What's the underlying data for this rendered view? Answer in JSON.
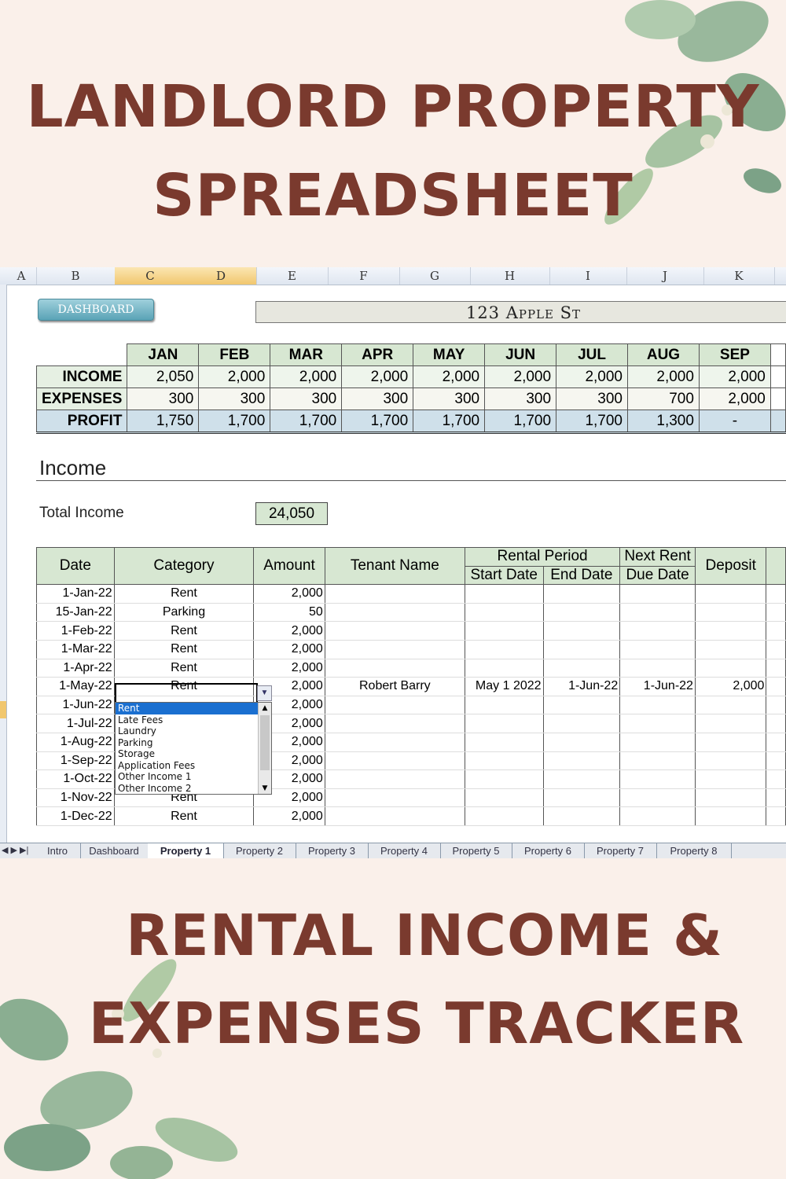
{
  "header": {
    "line1": "LANDLORD PROPERTY",
    "line2": "SPREADSHEET"
  },
  "footer": {
    "line1": "RENTAL INCOME &",
    "line2": "EXPENSES TRACKER"
  },
  "sheet": {
    "columns": [
      "A",
      "B",
      "C",
      "D",
      "E",
      "F",
      "G",
      "H",
      "I",
      "J",
      "K"
    ],
    "dashboard_button": "DASHBOARD",
    "address": "123 Apple St",
    "summary": {
      "months": [
        "JAN",
        "FEB",
        "MAR",
        "APR",
        "MAY",
        "JUN",
        "JUL",
        "AUG",
        "SEP"
      ],
      "rows": [
        {
          "label": "INCOME",
          "values": [
            "2,050",
            "2,000",
            "2,000",
            "2,000",
            "2,000",
            "2,000",
            "2,000",
            "2,000",
            "2,000"
          ]
        },
        {
          "label": "EXPENSES",
          "values": [
            "300",
            "300",
            "300",
            "300",
            "300",
            "300",
            "300",
            "700",
            "2,000"
          ]
        },
        {
          "label": "PROFIT",
          "values": [
            "1,750",
            "1,700",
            "1,700",
            "1,700",
            "1,700",
            "1,700",
            "1,700",
            "1,300",
            "-"
          ]
        }
      ]
    },
    "income_title": "Income",
    "total_income_label": "Total Income",
    "total_income_value": "24,050",
    "detail_headers": {
      "date": "Date",
      "category": "Category",
      "amount": "Amount",
      "tenant": "Tenant Name",
      "rental_period": "Rental Period",
      "start": "Start Date",
      "end": "End Date",
      "next_rent": "Next Rent",
      "due_date": "Due Date",
      "deposit": "Deposit"
    },
    "detail_rows": [
      {
        "date": "1-Jan-22",
        "category": "Rent",
        "amount": "2,000",
        "tenant": "",
        "start": "",
        "end": "",
        "due": "",
        "deposit": ""
      },
      {
        "date": "15-Jan-22",
        "category": "Parking",
        "amount": "50",
        "tenant": "",
        "start": "",
        "end": "",
        "due": "",
        "deposit": ""
      },
      {
        "date": "1-Feb-22",
        "category": "Rent",
        "amount": "2,000",
        "tenant": "",
        "start": "",
        "end": "",
        "due": "",
        "deposit": ""
      },
      {
        "date": "1-Mar-22",
        "category": "Rent",
        "amount": "2,000",
        "tenant": "",
        "start": "",
        "end": "",
        "due": "",
        "deposit": ""
      },
      {
        "date": "1-Apr-22",
        "category": "Rent",
        "amount": "2,000",
        "tenant": "",
        "start": "",
        "end": "",
        "due": "",
        "deposit": ""
      },
      {
        "date": "1-May-22",
        "category": "Rent",
        "amount": "2,000",
        "tenant": "Robert Barry",
        "start": "May 1 2022",
        "end": "1-Jun-22",
        "due": "1-Jun-22",
        "deposit": "2,000"
      },
      {
        "date": "1-Jun-22",
        "category": "",
        "amount": "2,000",
        "tenant": "",
        "start": "",
        "end": "",
        "due": "",
        "deposit": ""
      },
      {
        "date": "1-Jul-22",
        "category": "",
        "amount": "2,000",
        "tenant": "",
        "start": "",
        "end": "",
        "due": "",
        "deposit": ""
      },
      {
        "date": "1-Aug-22",
        "category": "",
        "amount": "2,000",
        "tenant": "",
        "start": "",
        "end": "",
        "due": "",
        "deposit": ""
      },
      {
        "date": "1-Sep-22",
        "category": "",
        "amount": "2,000",
        "tenant": "",
        "start": "",
        "end": "",
        "due": "",
        "deposit": ""
      },
      {
        "date": "1-Oct-22",
        "category": "",
        "amount": "2,000",
        "tenant": "",
        "start": "",
        "end": "",
        "due": "",
        "deposit": ""
      },
      {
        "date": "1-Nov-22",
        "category": "Rent",
        "amount": "2,000",
        "tenant": "",
        "start": "",
        "end": "",
        "due": "",
        "deposit": ""
      },
      {
        "date": "1-Dec-22",
        "category": "Rent",
        "amount": "2,000",
        "tenant": "",
        "start": "",
        "end": "",
        "due": "",
        "deposit": ""
      }
    ],
    "dropdown_options": [
      "Rent",
      "Late Fees",
      "Laundry",
      "Parking",
      "Storage",
      "Application Fees",
      "Other Income 1",
      "Other Income 2"
    ],
    "dropdown_selected": "Rent",
    "tabs": [
      "Intro",
      "Dashboard",
      "Property 1",
      "Property 2",
      "Property 3",
      "Property 4",
      "Property 5",
      "Property 6",
      "Property 7",
      "Property 8"
    ],
    "active_tab": "Property 1"
  },
  "colors": {
    "title": "#7a3a2e",
    "header_green": "#d7e7d2",
    "profit_blue": "#cfe0ea",
    "background": "#faf0ea"
  }
}
